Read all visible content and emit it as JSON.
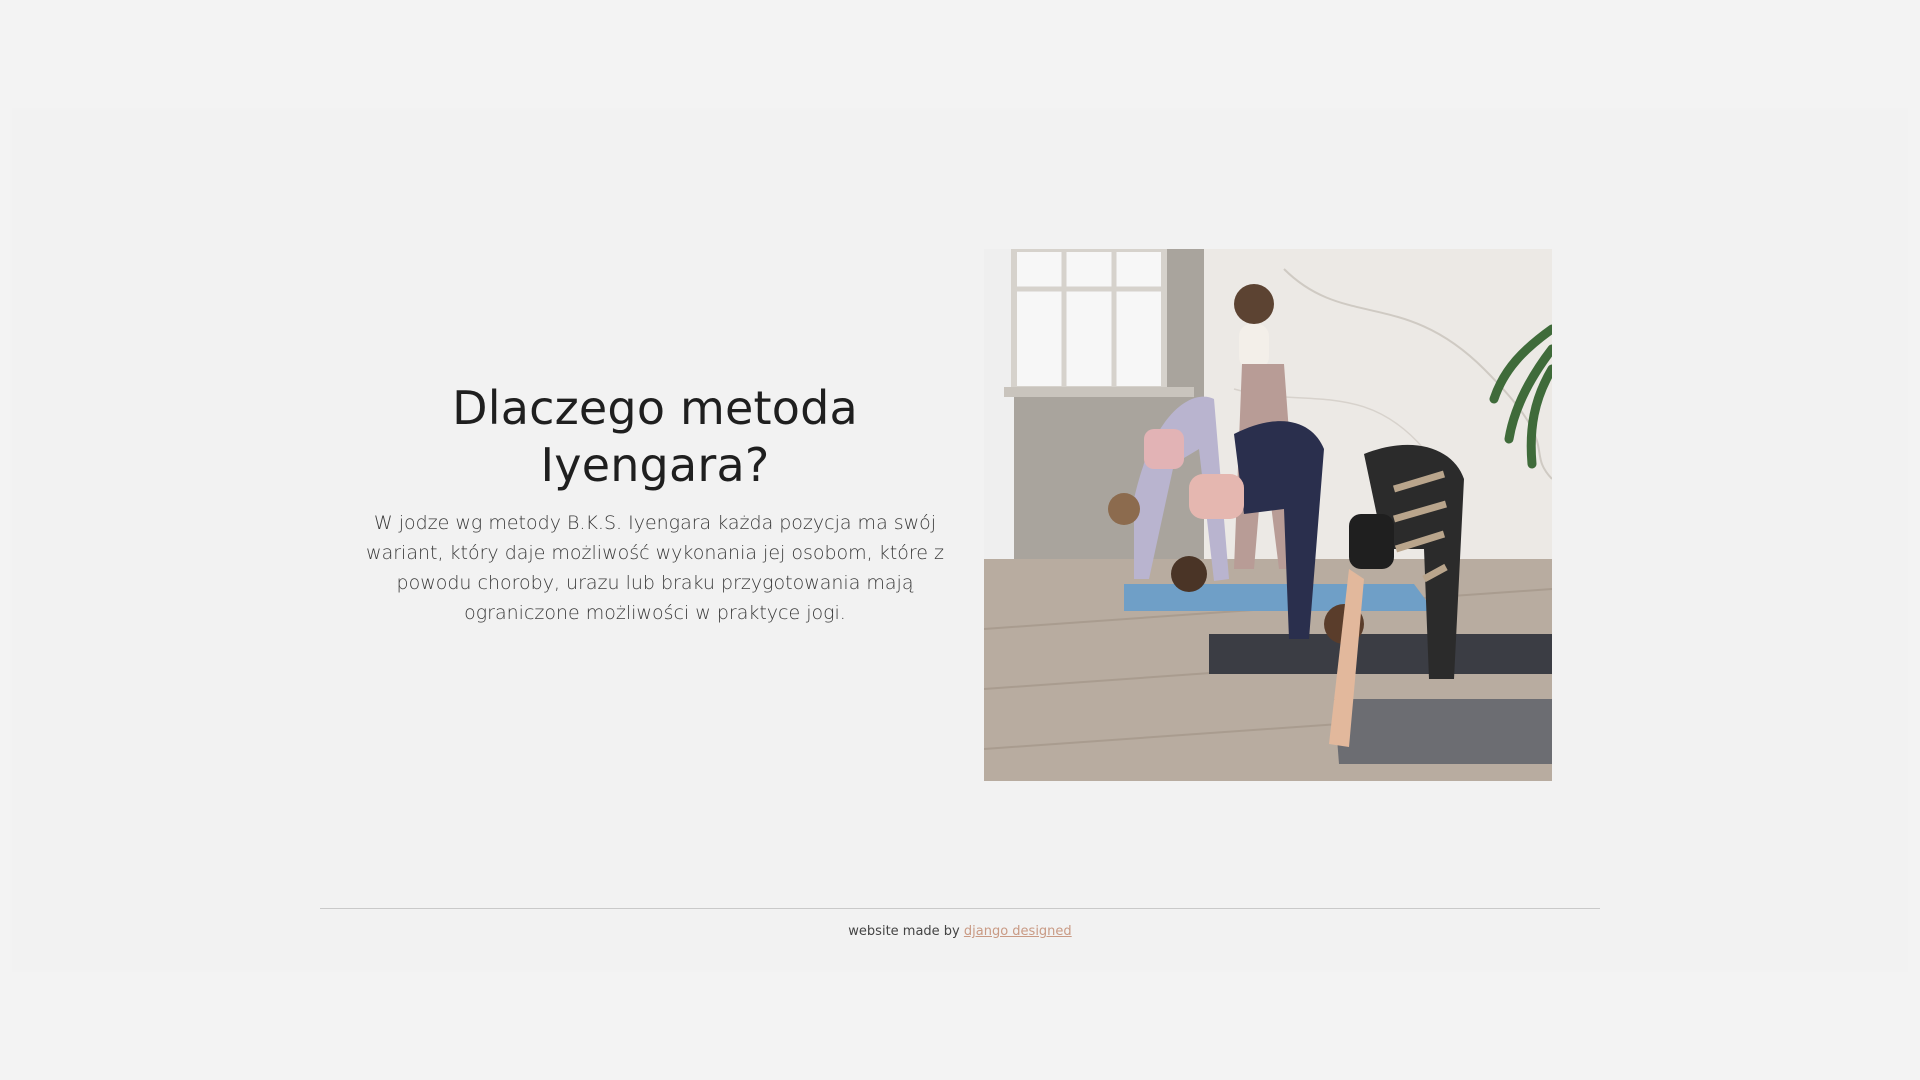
{
  "content": {
    "heading": "Dlaczego metoda Iyengara?",
    "body": "W jodze wg metody B.K.S. Iyengara każda pozycja ma swój wariant, który daje możliwość wykonania jej osobom, które z powodu choroby, urazu lub braku przygotowania mają ograniczone możliwości w praktyce jogi."
  },
  "photo": {
    "icon": "yoga-class-photo"
  },
  "footer": {
    "prefix": "website made by",
    "link_label": "django designed"
  },
  "colors": {
    "background": "#f3f3f3",
    "text": "#1f1f1f",
    "link": "#c99a84",
    "divider": "#c9c9c9"
  }
}
